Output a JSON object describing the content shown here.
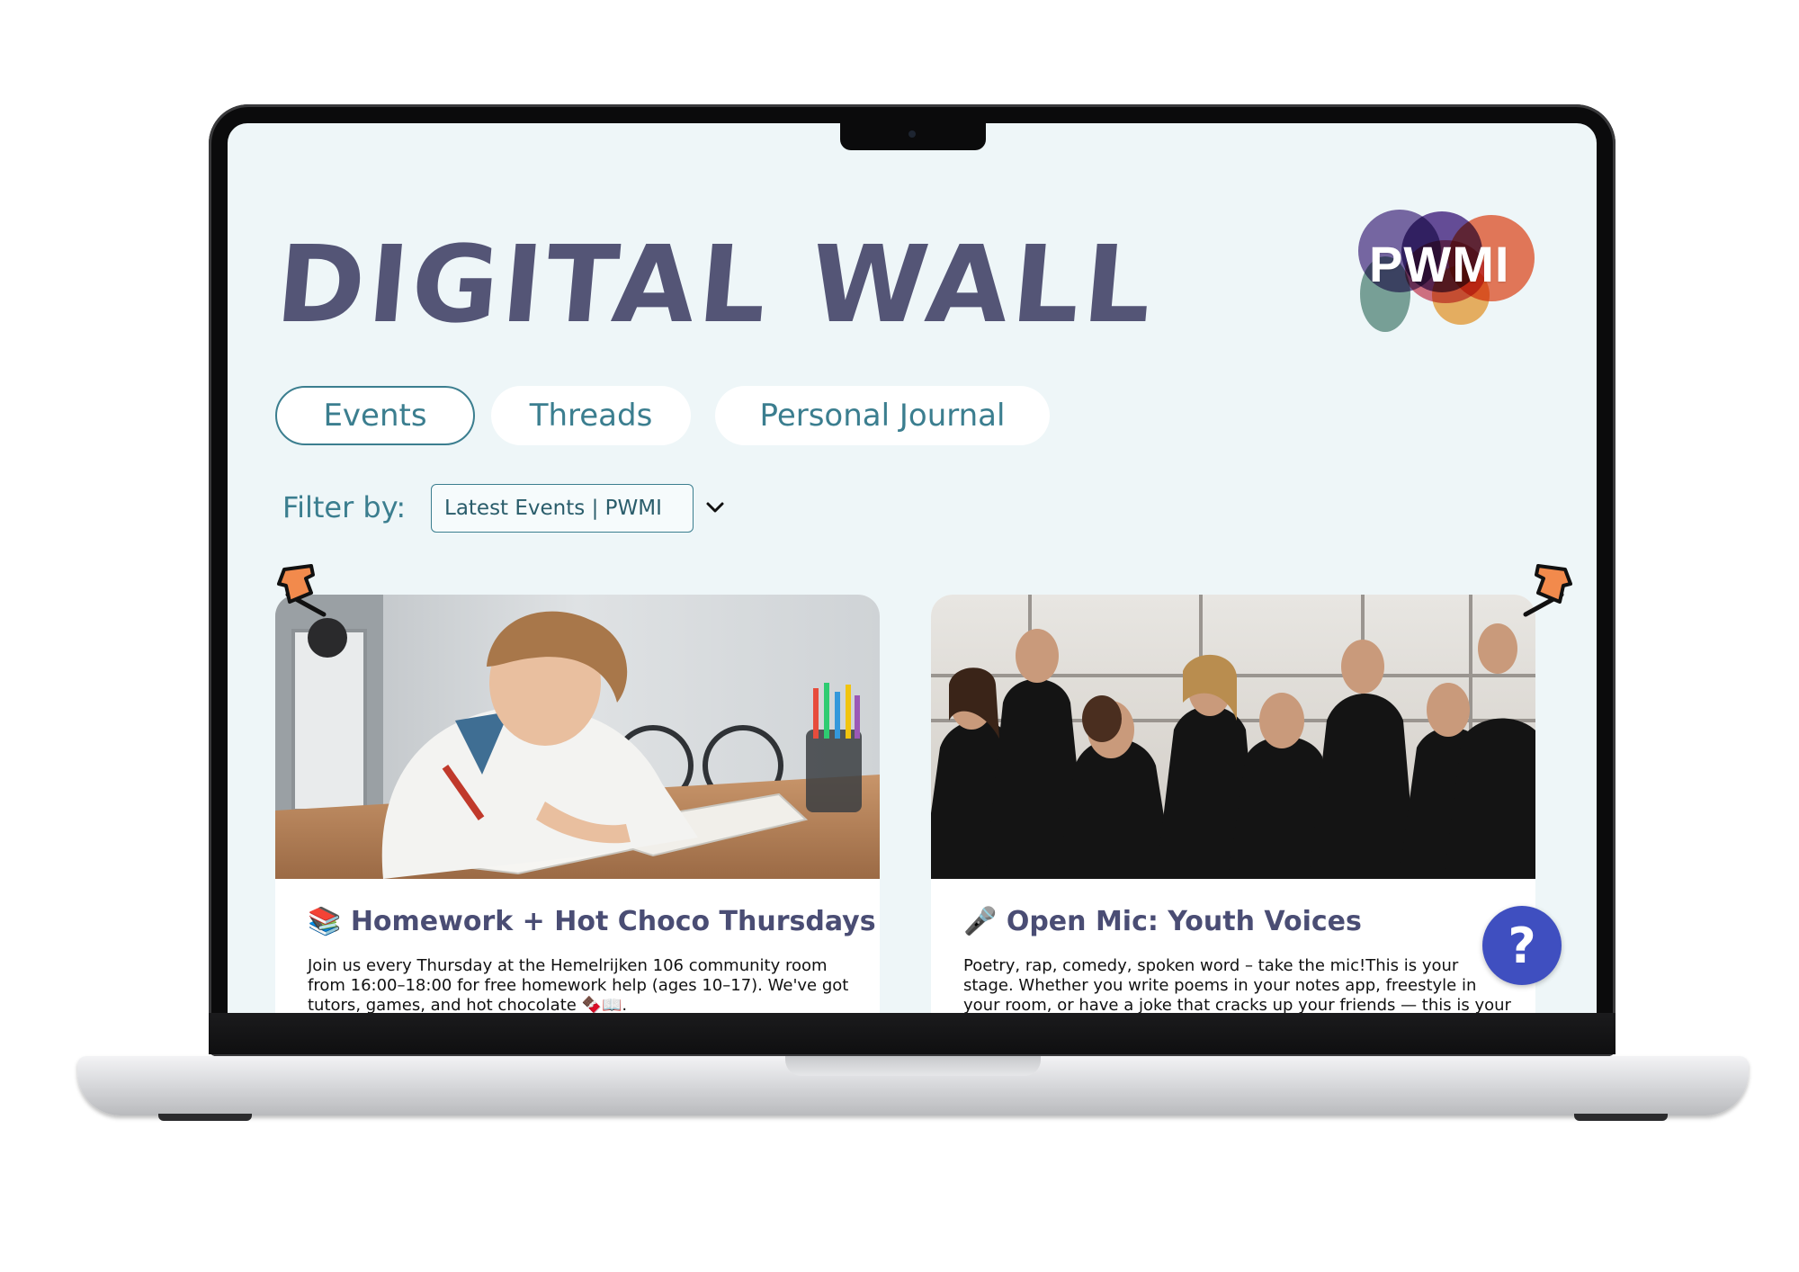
{
  "page": {
    "title": "DIGITAL WALL"
  },
  "logo": {
    "text": "PWMI"
  },
  "tabs": [
    {
      "label": "Events",
      "active": true
    },
    {
      "label": "Threads",
      "active": false
    },
    {
      "label": "Personal Journal",
      "active": false
    }
  ],
  "filter": {
    "label": "Filter by:",
    "selected": "Latest Events | PWMI"
  },
  "cards": [
    {
      "emoji": "📚",
      "title": "Homework + Hot Choco Thursdays",
      "body": "Join us every Thursday at the Hemelrijken 106 community room from 16:00–18:00 for free homework help (ages 10–17). We've got tutors, games, and hot chocolate 🍫📖.",
      "image": "boy-doing-homework-photo"
    },
    {
      "emoji": "🎤",
      "title": "Open Mic: Youth Voices",
      "body": "Poetry, rap, comedy, spoken word – take the mic!This is your stage. Whether you write poems in your notes app, freestyle in your room, or have a joke that cracks up your friends — this is your chance to",
      "image": "youth-choir-singing-photo"
    }
  ],
  "help": {
    "label": "?"
  },
  "colors": {
    "accent": "#3b7e8f",
    "title": "#545576",
    "help": "#3f4fc0",
    "pin": "#f28a4c"
  }
}
